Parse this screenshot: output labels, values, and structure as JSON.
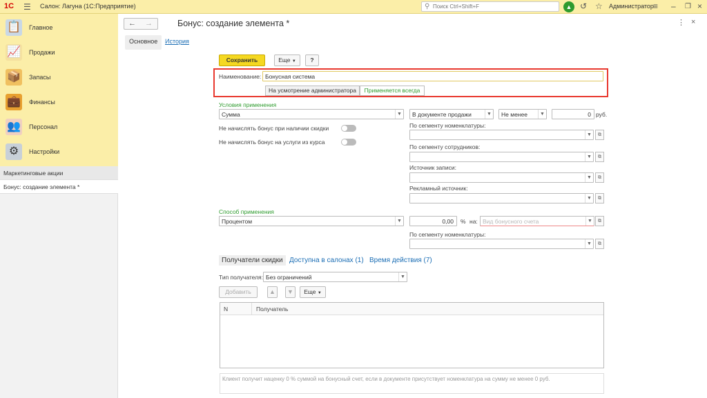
{
  "topbar": {
    "logo": "1С",
    "title": "Салон: Лагуна  (1С:Предприятие)",
    "search_placeholder": "Поиск Ctrl+Shift+F",
    "user": "Администратор"
  },
  "sidebar": {
    "sections": [
      {
        "label": "Главное",
        "icon": "clipboard-icon"
      },
      {
        "label": "Продажи",
        "icon": "chart-icon"
      },
      {
        "label": "Запасы",
        "icon": "box-icon"
      },
      {
        "label": "Финансы",
        "icon": "wallet-icon"
      },
      {
        "label": "Персонал",
        "icon": "people-icon"
      },
      {
        "label": "Настройки",
        "icon": "gear-icon"
      }
    ],
    "history": [
      {
        "label": "Маркетинговые акции"
      },
      {
        "label": "Бонус: создание элемента *"
      }
    ]
  },
  "form": {
    "title": "Бонус: создание элемента *",
    "tab_main": "Основное",
    "tab_history": "История",
    "save_label": "Сохранить",
    "more_label": "Еще",
    "help_label": "?",
    "name_label": "Наименование:",
    "name_value": "Бонусная система",
    "seg_admin": "На усмотрение администратора",
    "seg_always": "Применяется всегда",
    "conditions_header": "Условия применения",
    "condition_type": "Сумма",
    "doc_scope": "В документе продажи",
    "comparison": "Не менее",
    "amount": "0",
    "currency": "руб.",
    "no_bonus_discount": "Не начислять бонус при наличии скидки",
    "no_bonus_course": "Не начислять бонус на услуги из курса",
    "by_nomenclature": "По сегменту номенклатуры:",
    "by_employees": "По сегменту сотрудников:",
    "record_source": "Источник записи:",
    "ad_source": "Рекламный источник:",
    "method_header": "Способ применения",
    "method_type": "Процентом",
    "percent_value": "0,00",
    "percent_sign": "%",
    "to_label": "на:",
    "bonus_account_placeholder": "Вид бонусного счета",
    "by_nomenclature2": "По сегменту номенклатуры:",
    "subtabs": [
      "Получатели скидки",
      "Доступна в салонах (1)",
      "Время действия (7)"
    ],
    "recipient_type_label": "Тип получателя:",
    "recipient_type_value": "Без ограничений",
    "add_label": "Добавить",
    "more_label2": "Еще",
    "col_n": "N",
    "col_recipient": "Получатель",
    "note": "Клиент получит наценку 0 % суммой на бонусный счет, если в документе присутствует номенклатура на сумму не менее 0 руб."
  },
  "colors": {
    "accent": "#f5d821",
    "highlight": "#e8382e",
    "link": "#1a6db4",
    "green": "#2e9b2e"
  }
}
